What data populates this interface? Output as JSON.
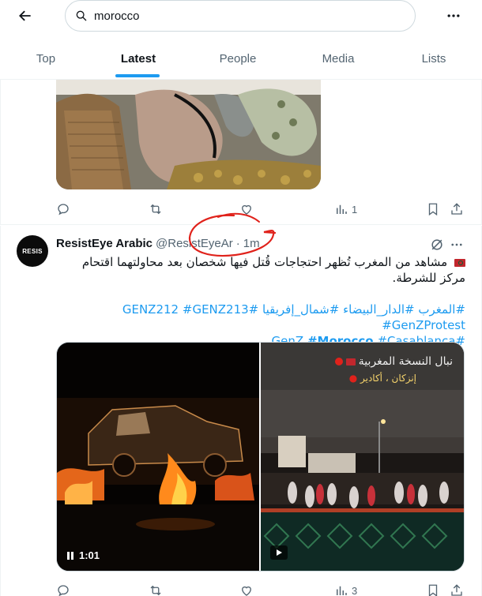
{
  "search": {
    "query": "morocco"
  },
  "tabs": [
    {
      "label": "Top",
      "active": false
    },
    {
      "label": "Latest",
      "active": true
    },
    {
      "label": "People",
      "active": false
    },
    {
      "label": "Media",
      "active": false
    },
    {
      "label": "Lists",
      "active": false
    }
  ],
  "tweet1": {
    "actions": {
      "reply": "",
      "retweet": "",
      "like": "",
      "views": "1"
    }
  },
  "tweet2": {
    "avatar_text": "RESIS",
    "name": "ResistEye Arabic",
    "handle": "@ResistEyeAr",
    "dot": "·",
    "time": "1m",
    "text": "مشاهد من المغرب تُظهر احتجاجات قُتل فيها شخصان بعد محاولتهما اقتحام مركز للشرطة.",
    "hashtags_line1": [
      "#المغرب",
      "#الدار_البيضاء",
      "#شمال_إفريقيا",
      "#GENZ212",
      "#GENZ213",
      "#GenZProtest"
    ],
    "hashtags_line2": [
      "#GenZ",
      "#Morocco",
      "#Casablanca"
    ],
    "media": {
      "video_duration": "1:01",
      "overlay_title": "نبال النسخة المغربية",
      "overlay_sub": "إنزكان ، أكادير"
    },
    "actions": {
      "reply": "",
      "retweet": "",
      "like": "",
      "views": "3"
    }
  },
  "colors": {
    "accent": "#1d9bf0",
    "text_primary": "#0f1419",
    "text_secondary": "#536471",
    "annotation_red": "#e0221b"
  },
  "icons": [
    "back-arrow-icon",
    "search-icon",
    "more-icon",
    "reply-icon",
    "retweet-icon",
    "like-icon",
    "views-icon",
    "bookmark-icon",
    "share-icon",
    "grok-icon",
    "pause-icon",
    "play-icon"
  ]
}
